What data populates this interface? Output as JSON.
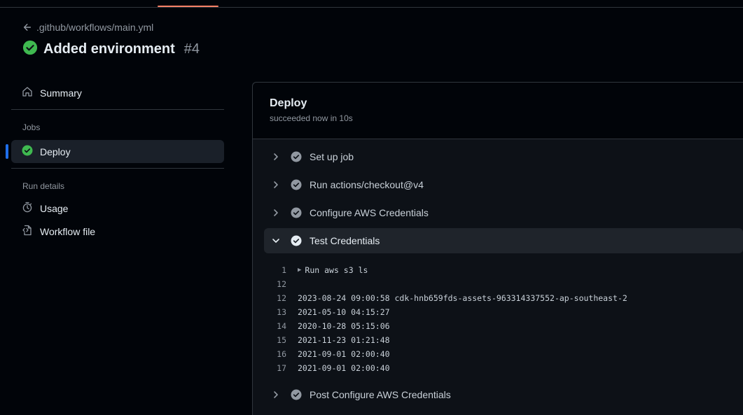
{
  "breadcrumb": {
    "path": ".github/workflows/main.yml"
  },
  "run": {
    "title": "Added environment",
    "number": "#4"
  },
  "sidebar": {
    "summary_label": "Summary",
    "jobs_heading": "Jobs",
    "jobs": [
      {
        "label": "Deploy",
        "status": "success"
      }
    ],
    "run_details_heading": "Run details",
    "usage_label": "Usage",
    "workflow_file_label": "Workflow file"
  },
  "job": {
    "title": "Deploy",
    "subtitle": "succeeded now in 10s",
    "steps": [
      {
        "label": "Set up job",
        "expanded": false
      },
      {
        "label": "Run actions/checkout@v4",
        "expanded": false
      },
      {
        "label": "Configure AWS Credentials",
        "expanded": false
      },
      {
        "label": "Test Credentials",
        "expanded": true
      },
      {
        "label": "Post Configure AWS Credentials",
        "expanded": false
      }
    ],
    "log": [
      {
        "num": "1",
        "text": "Run aws s3 ls",
        "group": true
      },
      {
        "num": "12",
        "text": ""
      },
      {
        "num": "12",
        "text": "2023-08-24 09:00:58 cdk-hnb659fds-assets-963314337552-ap-southeast-2"
      },
      {
        "num": "13",
        "text": "2021-05-10 04:15:27"
      },
      {
        "num": "14",
        "text": "2020-10-28 05:15:06"
      },
      {
        "num": "15",
        "text": "2021-11-23 01:21:48"
      },
      {
        "num": "16",
        "text": "2021-09-01 02:00:40"
      },
      {
        "num": "17",
        "text": "2021-09-01 02:00:40"
      }
    ]
  },
  "colors": {
    "success": "#3fb950",
    "accent": "#1f6feb",
    "tab_underline": "#f78166"
  }
}
